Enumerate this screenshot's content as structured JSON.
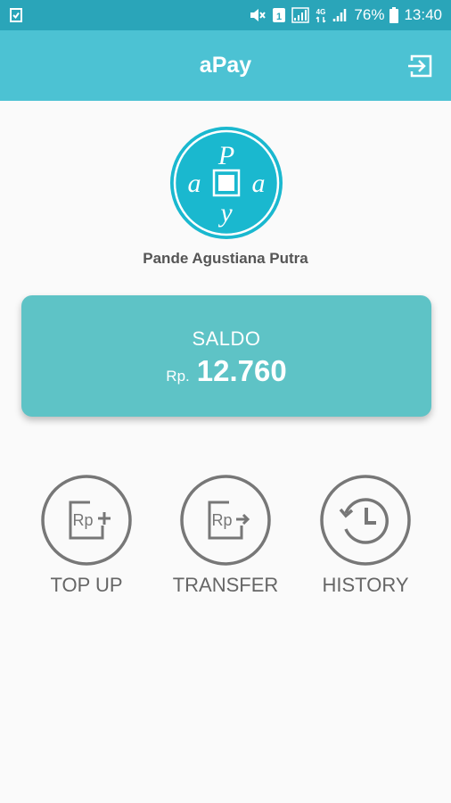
{
  "status_bar": {
    "battery_percent": "76%",
    "time": "13:40",
    "network_label": "4G"
  },
  "app_bar": {
    "title": "aPay",
    "logout_icon": "logout-icon"
  },
  "logo": {
    "letters": {
      "top": "P",
      "left": "a",
      "right": "a",
      "bottom": "y"
    }
  },
  "user": {
    "name": "Pande Agustiana Putra"
  },
  "balance": {
    "label": "SALDO",
    "currency": "Rp.",
    "amount": "12.760"
  },
  "menu": {
    "topup": {
      "label": "TOP UP",
      "icon": "rp-plus-icon",
      "icon_text": "Rp"
    },
    "transfer": {
      "label": "TRANSFER",
      "icon": "rp-arrow-icon",
      "icon_text": "Rp"
    },
    "history": {
      "label": "HISTORY",
      "icon": "history-icon"
    }
  },
  "colors": {
    "status_bar": "#2aa5b9",
    "app_bar": "#4cc2d3",
    "card": "#5ec3c6",
    "logo": "#1ab8cf",
    "menu_gray": "#777777"
  }
}
